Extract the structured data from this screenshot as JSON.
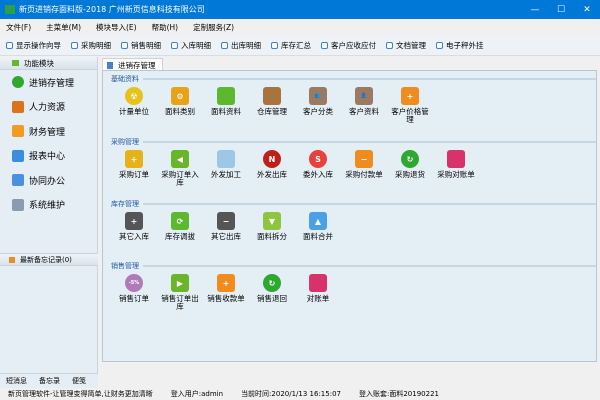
{
  "window": {
    "title": "新页进销存面料版-2018 广州新页信息科技有限公司",
    "icon_text": "新页",
    "minimize": "—",
    "maximize": "☐",
    "close": "✕"
  },
  "menu": [
    "文件(F)",
    "主菜单(M)",
    "模块导入(E)",
    "帮助(H)",
    "定制服务(Z)"
  ],
  "toolbar": [
    "显示操作向导",
    "采购明细",
    "销售明细",
    "入库明细",
    "出库明细",
    "库存汇总",
    "客户应收应付",
    "文档管理",
    "电子秤外挂"
  ],
  "sidebar": {
    "header": "功能模块",
    "items": [
      {
        "label": "进销存管理",
        "icon": "check-circle-icon",
        "color": "#2fa82f"
      },
      {
        "label": "人力资源",
        "icon": "people-icon",
        "color": "#d8741c"
      },
      {
        "label": "财务管理",
        "icon": "folder-icon",
        "color": "#f39a22"
      },
      {
        "label": "报表中心",
        "icon": "refresh-report-icon",
        "color": "#3a8ee0"
      },
      {
        "label": "协同办公",
        "icon": "calendar-icon",
        "color": "#4a90e2"
      },
      {
        "label": "系统维护",
        "icon": "lock-icon",
        "color": "#8a9bb0"
      }
    ],
    "memo": "最新备忘记录(0)",
    "bottom_tabs": [
      "短消息",
      "备忘录",
      "便笺"
    ]
  },
  "tab": "进销存管理",
  "sections": [
    {
      "title": "基础资料",
      "items": [
        {
          "label": "计量单位",
          "icon": "radiation-icon",
          "color": "#e6c21a",
          "glyph": "☢"
        },
        {
          "label": "面料类别",
          "icon": "gears-icon",
          "color": "#e8a21a",
          "glyph": "⚙"
        },
        {
          "label": "面料资料",
          "icon": "bag-icon",
          "color": "#5cb82e",
          "glyph": ""
        },
        {
          "label": "仓库管理",
          "icon": "box-icon",
          "color": "#a8743e",
          "glyph": ""
        },
        {
          "label": "客户分类",
          "icon": "users-icon",
          "color": "#9a7a60",
          "glyph": "👥"
        },
        {
          "label": "客户资料",
          "icon": "user-icon",
          "color": "#9a7a60",
          "glyph": "👤"
        },
        {
          "label": "客户价格管理",
          "icon": "rss-add-icon",
          "color": "#f08c1e",
          "glyph": "+"
        }
      ]
    },
    {
      "title": "采购管理",
      "items": [
        {
          "label": "采购订单",
          "icon": "cart-add-icon",
          "color": "#e6b21a",
          "glyph": "+"
        },
        {
          "label": "采购订单入库",
          "icon": "arrow-left-icon",
          "color": "#6bb52a",
          "glyph": "◀"
        },
        {
          "label": "外发加工",
          "icon": "folder-open-icon",
          "color": "#9ec6e6",
          "glyph": ""
        },
        {
          "label": "外发出库",
          "icon": "new-badge-icon",
          "color": "#c0201a",
          "glyph": "N"
        },
        {
          "label": "委外入库",
          "icon": "s-circle-icon",
          "color": "#e8403a",
          "glyph": "S"
        },
        {
          "label": "采购付款单",
          "icon": "rss-remove-icon",
          "color": "#f08c1e",
          "glyph": "−"
        },
        {
          "label": "采购退货",
          "icon": "return-circle-icon",
          "color": "#2fa82f",
          "glyph": "↻"
        },
        {
          "label": "采购对账单",
          "icon": "book-icon",
          "color": "#d8326a",
          "glyph": ""
        }
      ]
    },
    {
      "title": "库存管理",
      "items": [
        {
          "label": "其它入库",
          "icon": "cart-add-icon",
          "color": "#555555",
          "glyph": "+"
        },
        {
          "label": "库存调拔",
          "icon": "refresh-icon",
          "color": "#5cb82e",
          "glyph": "⟳"
        },
        {
          "label": "其它出库",
          "icon": "cart-remove-icon",
          "color": "#555555",
          "glyph": "−"
        },
        {
          "label": "面料拆分",
          "icon": "arrow-down-icon",
          "color": "#8cc63e",
          "glyph": "▼"
        },
        {
          "label": "面料合并",
          "icon": "arrow-up-icon",
          "color": "#4aa0e6",
          "glyph": "▲"
        }
      ]
    },
    {
      "title": "销售管理",
      "items": [
        {
          "label": "销售订单",
          "icon": "discount-sticker-icon",
          "color": "#b07ab8",
          "glyph": "-5%"
        },
        {
          "label": "销售订单出库",
          "icon": "arrow-right-icon",
          "color": "#6bb52a",
          "glyph": "▶"
        },
        {
          "label": "销售收款单",
          "icon": "rss-add-icon",
          "color": "#f08c1e",
          "glyph": "+"
        },
        {
          "label": "销售退回",
          "icon": "return-circle-icon",
          "color": "#2fa82f",
          "glyph": "↻"
        },
        {
          "label": "对账单",
          "icon": "book-icon",
          "color": "#d8326a",
          "glyph": ""
        }
      ]
    }
  ],
  "status": {
    "slogan": "新页管理软件-让管理变得简单,让财务更加清晰",
    "user": "登入用户:admin",
    "time": "当前时间:2020/1/13 16:15:07",
    "account": "登入账套:面料20190221"
  }
}
